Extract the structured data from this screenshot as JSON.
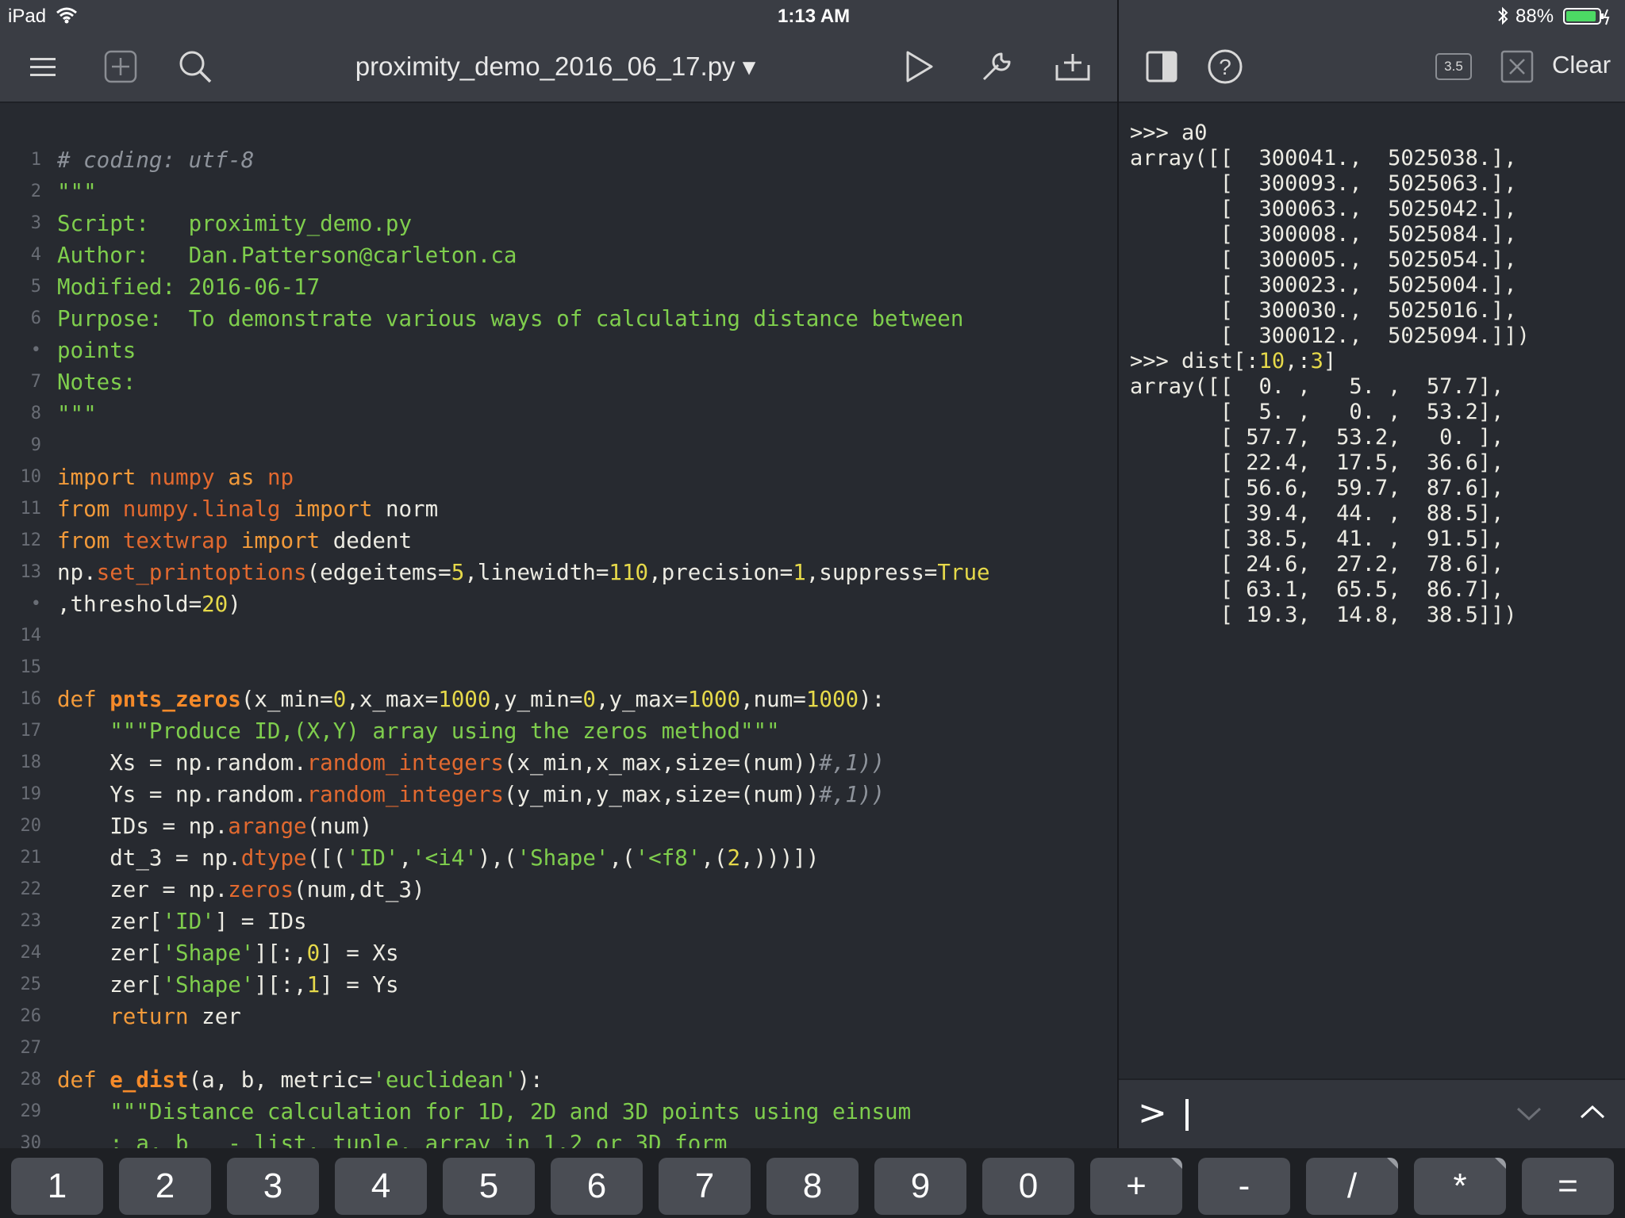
{
  "status_bar": {
    "device": "iPad",
    "time": "1:13 AM",
    "battery": "88%"
  },
  "editor_toolbar": {
    "file_title": "proximity_demo_2016_06_17.py ▾",
    "icons": [
      "menu-icon",
      "new-file-icon",
      "search-icon",
      "run-icon",
      "wrench-icon",
      "add-to-tray-icon"
    ]
  },
  "console_toolbar": {
    "version_badge": "3.5",
    "clear_label": "Clear",
    "icons": [
      "split-view-icon",
      "help-icon",
      "python-version-icon",
      "close-icon"
    ]
  },
  "editor": {
    "lines": [
      {
        "num": "1",
        "t": [
          [
            "c",
            "# coding: utf-8"
          ]
        ]
      },
      {
        "num": "2",
        "t": [
          [
            "s",
            "\"\"\""
          ]
        ]
      },
      {
        "num": "3",
        "t": [
          [
            "s",
            "Script:   proximity_demo.py"
          ]
        ]
      },
      {
        "num": "4",
        "t": [
          [
            "s",
            "Author:   Dan.Patterson@carleton.ca"
          ]
        ]
      },
      {
        "num": "5",
        "t": [
          [
            "s",
            "Modified: 2016-06-17"
          ]
        ]
      },
      {
        "num": "6",
        "t": [
          [
            "s",
            "Purpose:  To demonstrate various ways of calculating distance between"
          ]
        ]
      },
      {
        "num": "•",
        "t": [
          [
            "s",
            "points"
          ]
        ]
      },
      {
        "num": "7",
        "t": [
          [
            "s",
            "Notes:"
          ]
        ]
      },
      {
        "num": "8",
        "t": [
          [
            "s",
            "\"\"\""
          ]
        ]
      },
      {
        "num": "9",
        "t": []
      },
      {
        "num": "10",
        "t": [
          [
            "k",
            "import"
          ],
          [
            "p",
            " "
          ],
          [
            "m",
            "numpy"
          ],
          [
            "p",
            " "
          ],
          [
            "k",
            "as"
          ],
          [
            "p",
            " "
          ],
          [
            "m",
            "np"
          ]
        ]
      },
      {
        "num": "11",
        "t": [
          [
            "k",
            "from"
          ],
          [
            "p",
            " "
          ],
          [
            "m",
            "numpy.linalg"
          ],
          [
            "p",
            " "
          ],
          [
            "k",
            "import"
          ],
          [
            "p",
            " norm"
          ]
        ]
      },
      {
        "num": "12",
        "t": [
          [
            "k",
            "from"
          ],
          [
            "p",
            " "
          ],
          [
            "m",
            "textwrap"
          ],
          [
            "p",
            " "
          ],
          [
            "k",
            "import"
          ],
          [
            "p",
            " dedent"
          ]
        ]
      },
      {
        "num": "13",
        "t": [
          [
            "p",
            "np."
          ],
          [
            "m",
            "set_printoptions"
          ],
          [
            "p",
            "(edgeitems="
          ],
          [
            "n",
            "5"
          ],
          [
            "p",
            ",linewidth="
          ],
          [
            "n",
            "110"
          ],
          [
            "p",
            ",precision="
          ],
          [
            "n",
            "1"
          ],
          [
            "p",
            ",suppress="
          ],
          [
            "n",
            "True"
          ]
        ]
      },
      {
        "num": "•",
        "t": [
          [
            "p",
            ",threshold="
          ],
          [
            "n",
            "20"
          ],
          [
            "p",
            ")"
          ]
        ]
      },
      {
        "num": "14",
        "t": []
      },
      {
        "num": "15",
        "t": []
      },
      {
        "num": "16",
        "t": [
          [
            "k",
            "def"
          ],
          [
            "p",
            " "
          ],
          [
            "f",
            "pnts_zeros"
          ],
          [
            "p",
            "(x_min="
          ],
          [
            "n",
            "0"
          ],
          [
            "p",
            ",x_max="
          ],
          [
            "n",
            "1000"
          ],
          [
            "p",
            ",y_min="
          ],
          [
            "n",
            "0"
          ],
          [
            "p",
            ",y_max="
          ],
          [
            "n",
            "1000"
          ],
          [
            "p",
            ",num="
          ],
          [
            "n",
            "1000"
          ],
          [
            "p",
            "):"
          ]
        ]
      },
      {
        "num": "17",
        "t": [
          [
            "p",
            "    "
          ],
          [
            "s",
            "\"\"\"Produce ID,(X,Y) array using the zeros method\"\"\""
          ]
        ]
      },
      {
        "num": "18",
        "t": [
          [
            "p",
            "    Xs = np.random."
          ],
          [
            "m",
            "random_integers"
          ],
          [
            "p",
            "(x_min,x_max,size=(num))"
          ],
          [
            "c",
            "#,1))"
          ]
        ]
      },
      {
        "num": "19",
        "t": [
          [
            "p",
            "    Ys = np.random."
          ],
          [
            "m",
            "random_integers"
          ],
          [
            "p",
            "(y_min,y_max,size=(num))"
          ],
          [
            "c",
            "#,1))"
          ]
        ]
      },
      {
        "num": "20",
        "t": [
          [
            "p",
            "    IDs = np."
          ],
          [
            "m",
            "arange"
          ],
          [
            "p",
            "(num)"
          ]
        ]
      },
      {
        "num": "21",
        "t": [
          [
            "p",
            "    dt_3 = np."
          ],
          [
            "m",
            "dtype"
          ],
          [
            "p",
            "([("
          ],
          [
            "s",
            "'ID'"
          ],
          [
            "p",
            ","
          ],
          [
            "s",
            "'<i4'"
          ],
          [
            "p",
            "),("
          ],
          [
            "s",
            "'Shape'"
          ],
          [
            "p",
            ",("
          ],
          [
            "s",
            "'<f8'"
          ],
          [
            "p",
            ",("
          ],
          [
            "n",
            "2"
          ],
          [
            "p",
            ",)))])"
          ]
        ]
      },
      {
        "num": "22",
        "t": [
          [
            "p",
            "    zer = np."
          ],
          [
            "m",
            "zeros"
          ],
          [
            "p",
            "(num,dt_3)"
          ]
        ]
      },
      {
        "num": "23",
        "t": [
          [
            "p",
            "    zer["
          ],
          [
            "s",
            "'ID'"
          ],
          [
            "p",
            "] = IDs"
          ]
        ]
      },
      {
        "num": "24",
        "t": [
          [
            "p",
            "    zer["
          ],
          [
            "s",
            "'Shape'"
          ],
          [
            "p",
            "][:,"
          ],
          [
            "n",
            "0"
          ],
          [
            "p",
            "] = Xs"
          ]
        ]
      },
      {
        "num": "25",
        "t": [
          [
            "p",
            "    zer["
          ],
          [
            "s",
            "'Shape'"
          ],
          [
            "p",
            "][:,"
          ],
          [
            "n",
            "1"
          ],
          [
            "p",
            "] = Ys"
          ]
        ]
      },
      {
        "num": "26",
        "t": [
          [
            "p",
            "    "
          ],
          [
            "k",
            "return"
          ],
          [
            "p",
            " zer"
          ]
        ]
      },
      {
        "num": "27",
        "t": []
      },
      {
        "num": "28",
        "t": [
          [
            "k",
            "def"
          ],
          [
            "p",
            " "
          ],
          [
            "f",
            "e_dist"
          ],
          [
            "p",
            "(a, b, metric="
          ],
          [
            "s",
            "'euclidean'"
          ],
          [
            "p",
            "):"
          ]
        ]
      },
      {
        "num": "29",
        "t": [
          [
            "p",
            "    "
          ],
          [
            "s",
            "\"\"\"Distance calculation for 1D, 2D and 3D points using einsum"
          ]
        ]
      },
      {
        "num": "30",
        "t": [
          [
            "s",
            "    : a, b   - list, tuple, array in 1,2 or 3D form"
          ]
        ]
      }
    ]
  },
  "console": {
    "lines": [
      [
        [
          "p",
          ">>> a0"
        ]
      ],
      [
        [
          "p",
          "array([[  300041.,  5025038.],"
        ]
      ],
      [
        [
          "p",
          "       [  300093.,  5025063.],"
        ]
      ],
      [
        [
          "p",
          "       [  300063.,  5025042.],"
        ]
      ],
      [
        [
          "p",
          "       [  300008.,  5025084.],"
        ]
      ],
      [
        [
          "p",
          "       [  300005.,  5025054.],"
        ]
      ],
      [
        [
          "p",
          "       [  300023.,  5025004.],"
        ]
      ],
      [
        [
          "p",
          "       [  300030.,  5025016.],"
        ]
      ],
      [
        [
          "p",
          "       [  300012.,  5025094.]])"
        ]
      ],
      [
        [
          "p",
          ">>> dist[:"
        ],
        [
          "n",
          "10"
        ],
        [
          "p",
          ",:"
        ],
        [
          "n",
          "3"
        ],
        [
          "p",
          "]"
        ]
      ],
      [
        [
          "p",
          "array([[  0. ,   5. ,  57.7],"
        ]
      ],
      [
        [
          "p",
          "       [  5. ,   0. ,  53.2],"
        ]
      ],
      [
        [
          "p",
          "       [ 57.7,  53.2,   0. ],"
        ]
      ],
      [
        [
          "p",
          "       [ 22.4,  17.5,  36.6],"
        ]
      ],
      [
        [
          "p",
          "       [ 56.6,  59.7,  87.6],"
        ]
      ],
      [
        [
          "p",
          "       [ 39.4,  44. ,  88.5],"
        ]
      ],
      [
        [
          "p",
          "       [ 38.5,  41. ,  91.5],"
        ]
      ],
      [
        [
          "p",
          "       [ 24.6,  27.2,  78.6],"
        ]
      ],
      [
        [
          "p",
          "       [ 63.1,  65.5,  86.7],"
        ]
      ],
      [
        [
          "p",
          "       [ 19.3,  14.8,  38.5]])"
        ]
      ]
    ],
    "prompt": ">"
  },
  "keyboard_bar": {
    "keys": [
      "1",
      "2",
      "3",
      "4",
      "5",
      "6",
      "7",
      "8",
      "9",
      "0",
      "+",
      "-",
      "/",
      "*",
      "="
    ]
  },
  "colors": {
    "background": "#272a30",
    "toolbar": "#3a3d44",
    "comment": "#8e939b",
    "string": "#7fce4d",
    "keyword": "#f29a3a",
    "module": "#e2692f",
    "number": "#e6d94a",
    "battery": "#4cd964"
  }
}
